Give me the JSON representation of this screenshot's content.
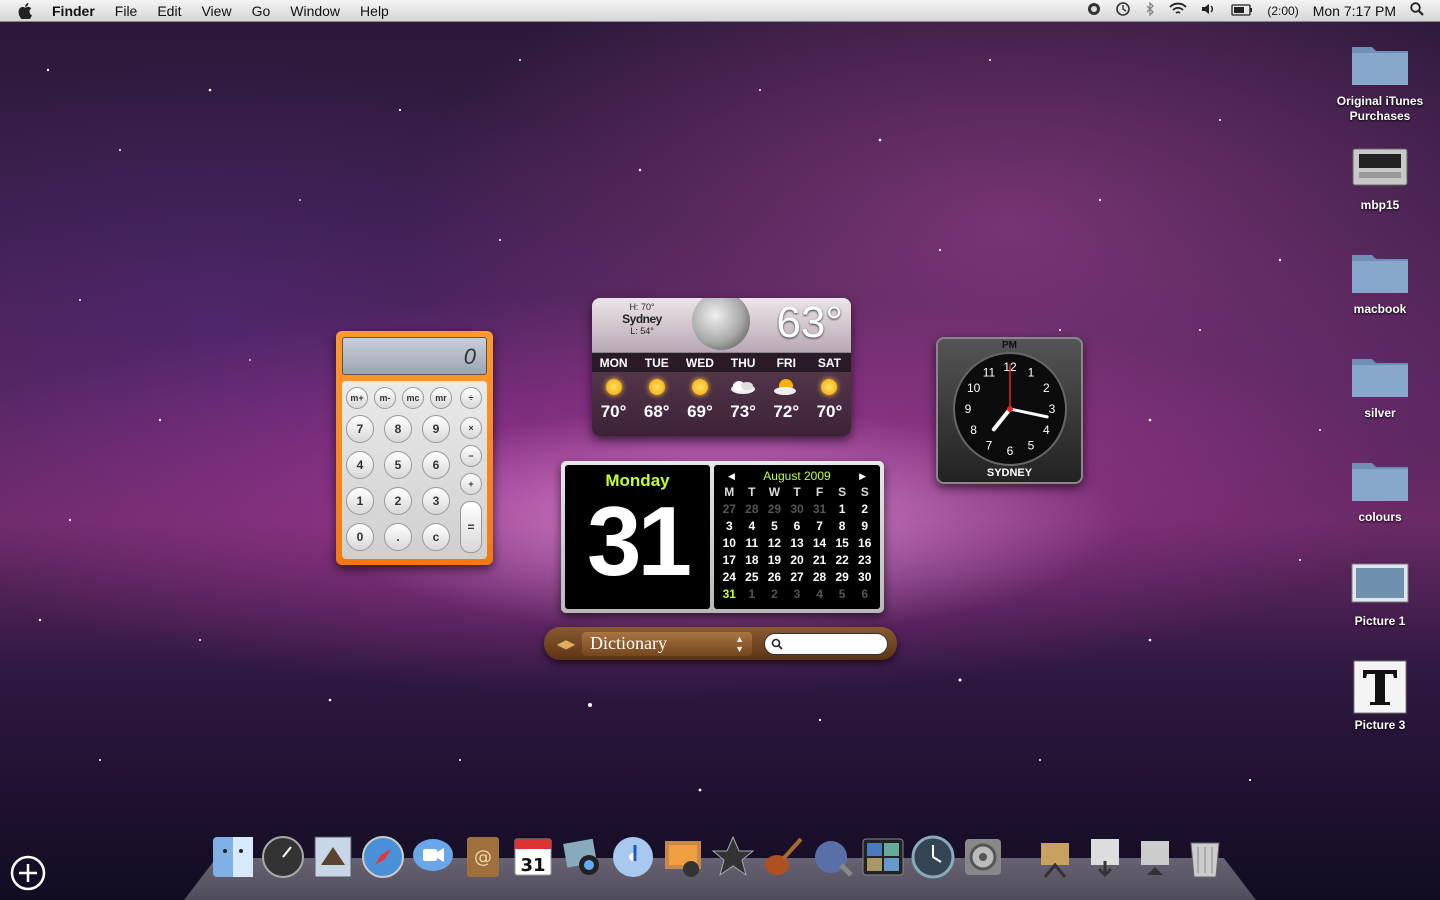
{
  "menubar": {
    "app_name": "Finder",
    "items": [
      "File",
      "Edit",
      "View",
      "Go",
      "Window",
      "Help"
    ],
    "battery_time": "(2:00)",
    "clock": "Mon 7:17 PM"
  },
  "desktop_icons": [
    {
      "label_line1": "Original iTunes",
      "label_line2": "Purchases",
      "icon": "folder-icon"
    },
    {
      "label_line1": "mbp15",
      "label_line2": "",
      "icon": "drive-icon"
    },
    {
      "label_line1": "macbook",
      "label_line2": "",
      "icon": "folder-icon"
    },
    {
      "label_line1": "silver",
      "label_line2": "",
      "icon": "folder-icon"
    },
    {
      "label_line1": "colours",
      "label_line2": "",
      "icon": "folder-icon"
    },
    {
      "label_line1": "Picture 1",
      "label_line2": "",
      "icon": "picture-icon"
    },
    {
      "label_line1": "Picture 3",
      "label_line2": "",
      "icon": "text-document-icon"
    }
  ],
  "calculator": {
    "display": "0",
    "memory_keys": [
      "m+",
      "m-",
      "mc",
      "mr"
    ],
    "op_keys": [
      "÷",
      "×",
      "−",
      "+",
      "="
    ],
    "digits": [
      "7",
      "8",
      "9",
      "4",
      "5",
      "6",
      "1",
      "2",
      "3",
      "0",
      ".",
      "c"
    ]
  },
  "weather": {
    "high": "H: 70°",
    "city": "Sydney",
    "low": "L: 54°",
    "current_temp": "63°",
    "days": [
      "MON",
      "TUE",
      "WED",
      "THU",
      "FRI",
      "SAT"
    ],
    "conditions": [
      "sunny",
      "sunny",
      "sunny",
      "cloudy",
      "partly-cloudy",
      "sunny"
    ],
    "temps": [
      "70°",
      "68°",
      "69°",
      "73°",
      "72°",
      "70°"
    ]
  },
  "calendar": {
    "day_name": "Monday",
    "day_number": "31",
    "month_title": "August 2009",
    "weekday_headers": [
      "M",
      "T",
      "W",
      "T",
      "F",
      "S",
      "S"
    ],
    "cells": [
      {
        "d": "27",
        "s": "dim"
      },
      {
        "d": "28",
        "s": "dim"
      },
      {
        "d": "29",
        "s": "dim"
      },
      {
        "d": "30",
        "s": "dim"
      },
      {
        "d": "31",
        "s": "dim"
      },
      {
        "d": "1",
        "s": ""
      },
      {
        "d": "2",
        "s": ""
      },
      {
        "d": "3",
        "s": ""
      },
      {
        "d": "4",
        "s": ""
      },
      {
        "d": "5",
        "s": ""
      },
      {
        "d": "6",
        "s": ""
      },
      {
        "d": "7",
        "s": ""
      },
      {
        "d": "8",
        "s": ""
      },
      {
        "d": "9",
        "s": ""
      },
      {
        "d": "10",
        "s": ""
      },
      {
        "d": "11",
        "s": ""
      },
      {
        "d": "12",
        "s": ""
      },
      {
        "d": "13",
        "s": ""
      },
      {
        "d": "14",
        "s": ""
      },
      {
        "d": "15",
        "s": ""
      },
      {
        "d": "16",
        "s": ""
      },
      {
        "d": "17",
        "s": ""
      },
      {
        "d": "18",
        "s": ""
      },
      {
        "d": "19",
        "s": ""
      },
      {
        "d": "20",
        "s": ""
      },
      {
        "d": "21",
        "s": ""
      },
      {
        "d": "22",
        "s": ""
      },
      {
        "d": "23",
        "s": ""
      },
      {
        "d": "24",
        "s": ""
      },
      {
        "d": "25",
        "s": ""
      },
      {
        "d": "26",
        "s": ""
      },
      {
        "d": "27",
        "s": ""
      },
      {
        "d": "28",
        "s": ""
      },
      {
        "d": "29",
        "s": ""
      },
      {
        "d": "30",
        "s": ""
      },
      {
        "d": "31",
        "s": "today"
      },
      {
        "d": "1",
        "s": "dim"
      },
      {
        "d": "2",
        "s": "dim"
      },
      {
        "d": "3",
        "s": "dim"
      },
      {
        "d": "4",
        "s": "dim"
      },
      {
        "d": "5",
        "s": "dim"
      },
      {
        "d": "6",
        "s": "dim"
      }
    ],
    "accent_color": "#c4ff2e"
  },
  "dictionary": {
    "source": "Dictionary",
    "search_value": ""
  },
  "world_clock": {
    "period": "PM",
    "city": "SYDNEY",
    "time_hour": 7,
    "time_minute": 17,
    "time_second": 0,
    "dial_numbers": [
      "12",
      "1",
      "2",
      "3",
      "4",
      "5",
      "6",
      "7",
      "8",
      "9",
      "10",
      "11"
    ]
  },
  "dock": {
    "items": [
      "finder-icon",
      "dashboard-icon",
      "mail-icon",
      "safari-icon",
      "ichat-icon",
      "address-book-icon",
      "ical-icon",
      "iphoto-icon",
      "itunes-icon",
      "photo-booth-icon",
      "imovie-icon",
      "garageband-icon",
      "preview-icon",
      "spaces-icon",
      "time-machine-icon",
      "system-preferences-icon",
      "applications-stack-icon",
      "downloads-stack-icon",
      "documents-stack-icon",
      "trash-icon"
    ]
  }
}
